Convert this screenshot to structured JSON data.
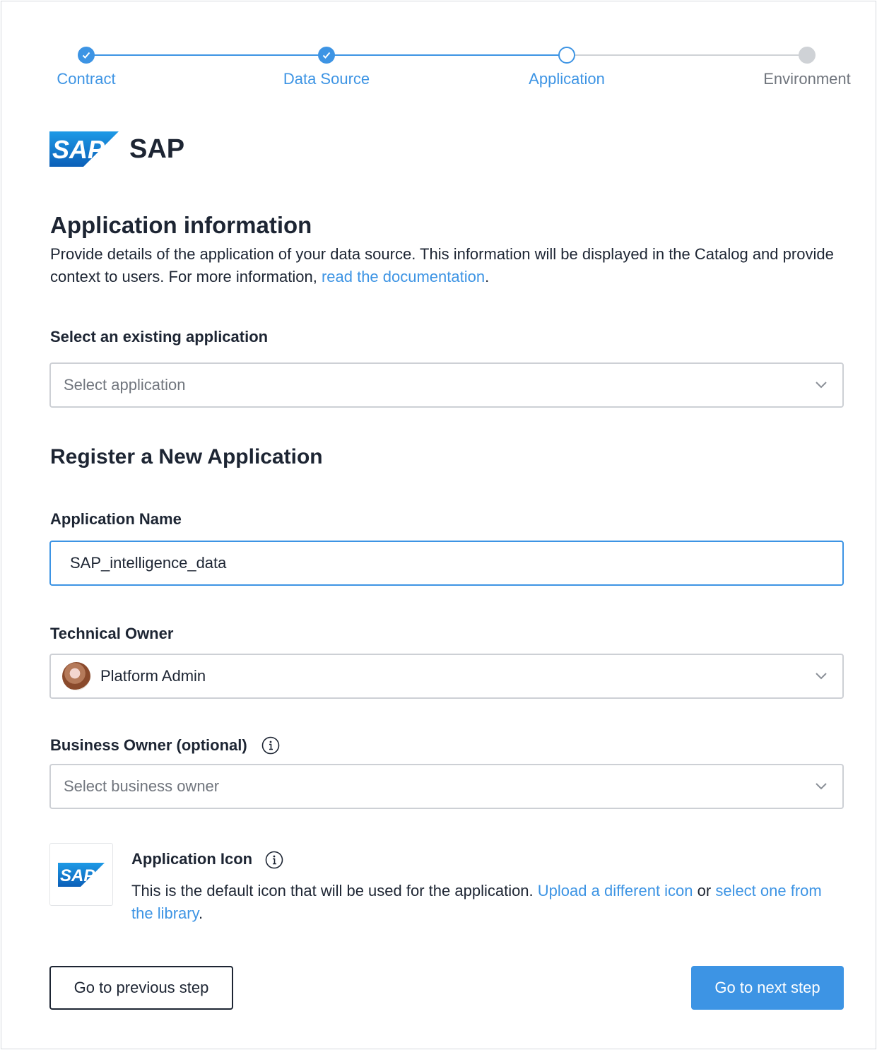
{
  "stepper": {
    "steps": [
      {
        "label": "Contract",
        "state": "done"
      },
      {
        "label": "Data Source",
        "state": "done"
      },
      {
        "label": "Application",
        "state": "current"
      },
      {
        "label": "Environment",
        "state": "todo"
      }
    ]
  },
  "header": {
    "logo_text": "SAP",
    "title": "SAP"
  },
  "section": {
    "title": "Application information",
    "description_prefix": "Provide details of the application of your data source. This information will be displayed in the Catalog and provide context to users. For more information, ",
    "description_link": "read the documentation",
    "description_suffix": "."
  },
  "existing_app": {
    "label": "Select an existing application",
    "placeholder": "Select application"
  },
  "register": {
    "title": "Register a New Application"
  },
  "app_name": {
    "label": "Application Name",
    "value": "SAP_intelligence_data"
  },
  "technical_owner": {
    "label": "Technical Owner",
    "value": "Platform Admin"
  },
  "business_owner": {
    "label": "Business Owner (optional)",
    "placeholder": "Select business owner"
  },
  "app_icon": {
    "title": "Application Icon",
    "desc_prefix": "This is the default icon that will be used for the application. ",
    "upload_link": "Upload a different icon",
    "desc_middle": " or ",
    "library_link": "select one from the library",
    "desc_suffix": "."
  },
  "actions": {
    "prev_label": "Go to previous step",
    "next_label": "Go to next step"
  },
  "colors": {
    "accent": "#3d94e4",
    "text": "#1d2533",
    "muted": "#70757d",
    "sap_blue": "#1b6fc8"
  }
}
